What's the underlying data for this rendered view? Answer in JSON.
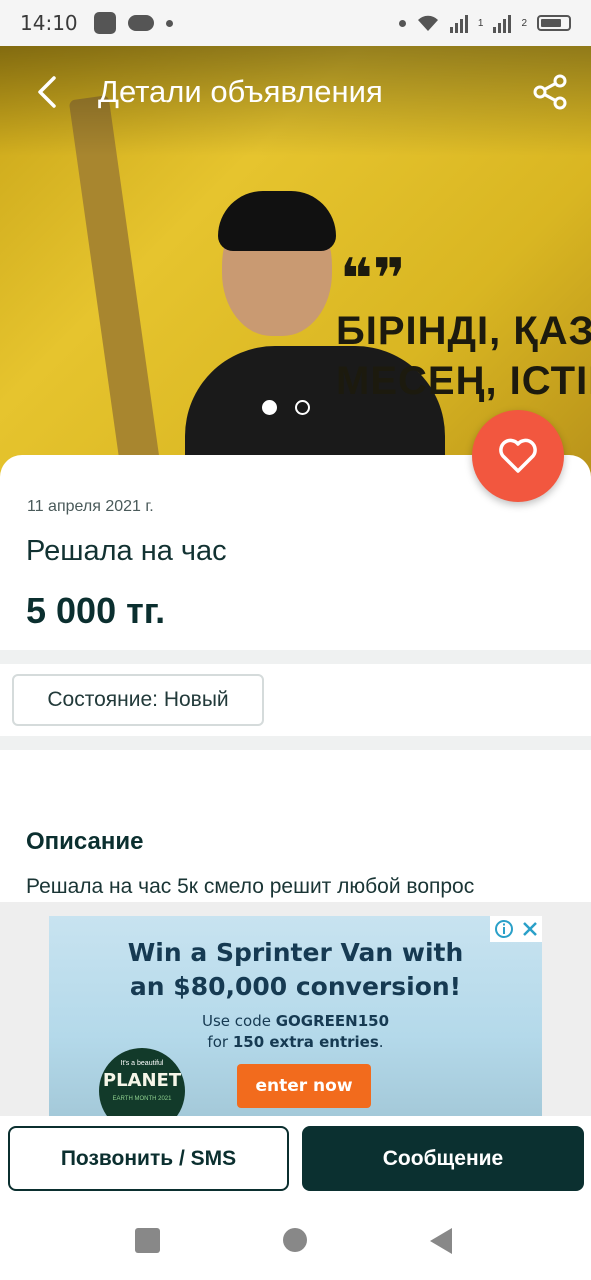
{
  "status_bar": {
    "time": "14:10",
    "sim1": "1",
    "sim2": "2"
  },
  "header": {
    "title": "Детали объявления",
    "back_icon": "back-arrow-icon",
    "share_icon": "share-icon"
  },
  "hero": {
    "wall_text_line1": "БІРІНДІ, ҚАЗАҚ,",
    "wall_text_line2": "МЕСЕҢ, ІСТІН",
    "quote_mark": "❝❞",
    "image_count": 2,
    "active_index": 0
  },
  "listing": {
    "date": "11 апреля 2021 г.",
    "title": "Решала на час",
    "price": "5 000 тг.",
    "condition": "Состояние: Новый",
    "description_heading": "Описание",
    "description_text": "Решала на час 5к смело решит любой вопрос"
  },
  "ad": {
    "headline_line1": "Win a Sprinter Van with",
    "headline_line2": "an $80,000 conversion!",
    "sub_prefix": "Use code ",
    "code": "GOGREEN150",
    "sub_line2_prefix": "for ",
    "sub_line2_bold": "150 extra entries",
    "sub_line2_suffix": ".",
    "cta": "enter now",
    "planet_small": "It's a beautiful",
    "planet_big": "PLANET",
    "planet_small2": "EARTH MONTH 2021"
  },
  "actions": {
    "call_label": "Позвонить / SMS",
    "message_label": "Сообщение"
  },
  "colors": {
    "accent": "#f2573f",
    "primary": "#0b3030",
    "cta_orange": "#f26b1d"
  }
}
